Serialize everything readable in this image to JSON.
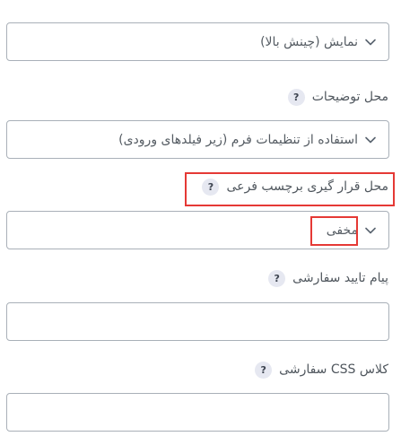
{
  "fields": {
    "display_select": {
      "value": "نمایش (چینش بالا)"
    },
    "description_location": {
      "label": "محل توضیحات",
      "help": "?",
      "value": "استفاده از تنظیمات فرم (زیر فیلدهای ورودی)"
    },
    "sublabel_location": {
      "label": "محل قرار گیری برچسب فرعی",
      "help": "?",
      "value": "مخفی"
    },
    "validation_message": {
      "label": "پیام تایید سفارشی",
      "help": "?",
      "value": ""
    },
    "custom_css_class": {
      "label": "کلاس CSS سفارشی",
      "help": "?",
      "value": ""
    }
  },
  "icons": {
    "chevron": "chevron-down-icon"
  },
  "colors": {
    "highlight": "#e53935",
    "border": "#a9b0b8",
    "help_badge_bg": "#e6e8f1"
  }
}
